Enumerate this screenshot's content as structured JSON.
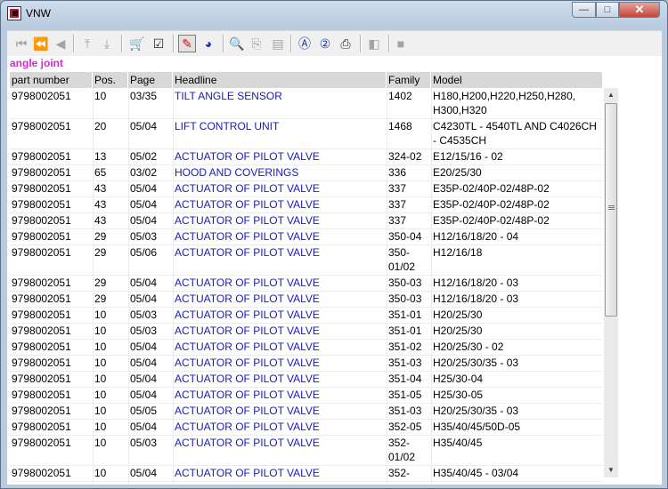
{
  "window": {
    "title": "VNW",
    "min_glyph": "—",
    "max_glyph": "□",
    "close_glyph": "✕"
  },
  "toolbar": {
    "buttons": [
      {
        "name": "first-record-icon",
        "glyph": "⏮"
      },
      {
        "name": "prev-page-icon",
        "glyph": "⏪"
      },
      {
        "name": "prev-record-icon",
        "glyph": "◀"
      },
      {
        "name": "back-page-icon",
        "glyph": "⤒"
      },
      {
        "name": "forward-page-icon",
        "glyph": "⤓"
      },
      {
        "name": "cart-icon",
        "glyph": "🛒"
      },
      {
        "name": "checklist-icon",
        "glyph": "☑"
      },
      {
        "name": "pen-icon",
        "glyph": "✎"
      },
      {
        "name": "globe-icon",
        "glyph": "◕"
      },
      {
        "name": "zoom-icon",
        "glyph": "🔍"
      },
      {
        "name": "page-fit-icon",
        "glyph": "⎘"
      },
      {
        "name": "page-icon",
        "glyph": "▤"
      },
      {
        "name": "search-a-icon",
        "glyph": "Ⓐ"
      },
      {
        "name": "help-icon",
        "glyph": "②"
      },
      {
        "name": "print-icon",
        "glyph": "⎙"
      },
      {
        "name": "disabled-tool-icon",
        "glyph": "◧"
      },
      {
        "name": "stop-icon",
        "glyph": "■"
      }
    ]
  },
  "list": {
    "heading": "angle joint",
    "columns": [
      "part number",
      "Pos.",
      "Page",
      "Headline",
      "Family",
      "Model"
    ],
    "rows": [
      {
        "part": "9798002051",
        "pos": "10",
        "page": "03/35",
        "headline": "TILT ANGLE SENSOR",
        "family": "1402",
        "model": "H180,H200,H220,H250,H280, H300,H320"
      },
      {
        "part": "9798002051",
        "pos": "20",
        "page": "05/04",
        "headline": "LIFT CONTROL UNIT",
        "family": "1468",
        "model": "C4230TL - 4540TL AND C4026CH - C4535CH"
      },
      {
        "part": "9798002051",
        "pos": "13",
        "page": "05/02",
        "headline": "ACTUATOR OF PILOT VALVE",
        "family": "324-02",
        "model": "E12/15/16 - 02"
      },
      {
        "part": "9798002051",
        "pos": "65",
        "page": "03/02",
        "headline": "HOOD AND COVERINGS",
        "family": "336",
        "model": "E20/25/30"
      },
      {
        "part": "9798002051",
        "pos": "43",
        "page": "05/04",
        "headline": "ACTUATOR OF PILOT VALVE",
        "family": "337",
        "model": "E35P-02/40P-02/48P-02"
      },
      {
        "part": "9798002051",
        "pos": "43",
        "page": "05/04",
        "headline": "ACTUATOR OF PILOT VALVE",
        "family": "337",
        "model": "E35P-02/40P-02/48P-02"
      },
      {
        "part": "9798002051",
        "pos": "43",
        "page": "05/04",
        "headline": "ACTUATOR OF PILOT VALVE",
        "family": "337",
        "model": "E35P-02/40P-02/48P-02"
      },
      {
        "part": "9798002051",
        "pos": "29",
        "page": "05/03",
        "headline": "ACTUATOR OF PILOT VALVE",
        "family": "350-04",
        "model": "H12/16/18/20 - 04"
      },
      {
        "part": "9798002051",
        "pos": "29",
        "page": "05/06",
        "headline": "ACTUATOR OF PILOT VALVE",
        "family": "350- 01/02",
        "model": "H12/16/18"
      },
      {
        "part": "9798002051",
        "pos": "29",
        "page": "05/04",
        "headline": "ACTUATOR OF PILOT VALVE",
        "family": "350-03",
        "model": "H12/16/18/20 - 03"
      },
      {
        "part": "9798002051",
        "pos": "29",
        "page": "05/04",
        "headline": "ACTUATOR OF PILOT VALVE",
        "family": "350-03",
        "model": "H12/16/18/20 - 03"
      },
      {
        "part": "9798002051",
        "pos": "10",
        "page": "05/03",
        "headline": "ACTUATOR OF PILOT VALVE",
        "family": "351-01",
        "model": "H20/25/30"
      },
      {
        "part": "9798002051",
        "pos": "10",
        "page": "05/03",
        "headline": "ACTUATOR OF PILOT VALVE",
        "family": "351-01",
        "model": "H20/25/30"
      },
      {
        "part": "9798002051",
        "pos": "10",
        "page": "05/04",
        "headline": "ACTUATOR OF PILOT VALVE",
        "family": "351-02",
        "model": "H20/25/30 - 02"
      },
      {
        "part": "9798002051",
        "pos": "10",
        "page": "05/04",
        "headline": "ACTUATOR OF PILOT VALVE",
        "family": "351-03",
        "model": "H20/25/30/35 - 03"
      },
      {
        "part": "9798002051",
        "pos": "10",
        "page": "05/04",
        "headline": "ACTUATOR OF PILOT VALVE",
        "family": "351-04",
        "model": "H25/30-04"
      },
      {
        "part": "9798002051",
        "pos": "10",
        "page": "05/04",
        "headline": "ACTUATOR OF PILOT VALVE",
        "family": "351-05",
        "model": "H25/30-05"
      },
      {
        "part": "9798002051",
        "pos": "10",
        "page": "05/05",
        "headline": "ACTUATOR OF PILOT VALVE",
        "family": "351-03",
        "model": "H20/25/30/35 - 03"
      },
      {
        "part": "9798002051",
        "pos": "10",
        "page": "05/04",
        "headline": "ACTUATOR OF PILOT VALVE",
        "family": "352-05",
        "model": "H35/40/45/50D-05"
      },
      {
        "part": "9798002051",
        "pos": "10",
        "page": "05/03",
        "headline": "ACTUATOR OF PILOT VALVE",
        "family": "352- 01/02",
        "model": "H35/40/45"
      },
      {
        "part": "9798002051",
        "pos": "10",
        "page": "05/04",
        "headline": "ACTUATOR OF PILOT VALVE",
        "family": "352-",
        "model": "H35/40/45 - 03/04"
      }
    ]
  },
  "scrollbar": {
    "up_glyph": "▲",
    "down_glyph": "▼"
  }
}
